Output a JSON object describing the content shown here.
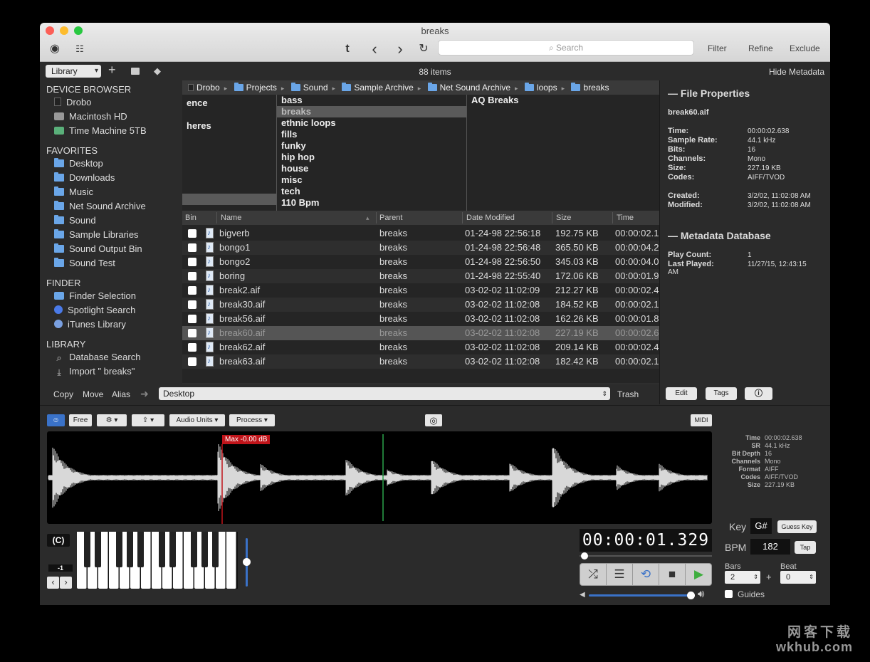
{
  "window": {
    "title": "breaks"
  },
  "toolbar": {
    "search_placeholder": "Search",
    "filter": "Filter",
    "refine": "Refine",
    "exclude": "Exclude",
    "back_icon": "‹",
    "forward_icon": "›"
  },
  "subbar": {
    "library_select": "Library",
    "item_count": "88 items",
    "hide_metadata": "Hide Metadata"
  },
  "sidebar": {
    "device_browser": {
      "header": "DEVICE BROWSER",
      "items": [
        "Drobo",
        "Macintosh HD",
        "Time Machine 5TB"
      ]
    },
    "favorites": {
      "header": "FAVORITES",
      "items": [
        "Desktop",
        "Downloads",
        "Music",
        "Net Sound Archive",
        "Sound",
        "Sample Libraries",
        "Sound Output Bin",
        "Sound Test"
      ]
    },
    "finder": {
      "header": "FINDER",
      "items": [
        "Finder Selection",
        "Spotlight Search",
        "iTunes Library"
      ]
    },
    "library": {
      "header": "LIBRARY",
      "items": [
        "Database Search",
        "Import \" breaks\""
      ]
    }
  },
  "path": [
    "Drobo",
    "Projects",
    "Sound",
    "Sample Archive",
    "Net Sound Archive",
    "loops",
    "breaks"
  ],
  "columns": {
    "col1": [
      "ence",
      "heres"
    ],
    "col2": [
      "bass",
      "breaks",
      "ethnic loops",
      "fills",
      "funky",
      "hip hop",
      "house",
      "misc",
      "tech",
      "110 Bpm"
    ],
    "col3": [
      "AQ Breaks"
    ]
  },
  "table": {
    "headers": {
      "bin": "Bin",
      "name": "Name",
      "parent": "Parent",
      "date": "Date Modified",
      "size": "Size",
      "time": "Time"
    },
    "rows": [
      {
        "name": "bigverb",
        "parent": "breaks",
        "date": "01-24-98 22:56:18",
        "size": "192.75 KB",
        "time": "00:00:02.1"
      },
      {
        "name": "bongo1",
        "parent": "breaks",
        "date": "01-24-98 22:56:48",
        "size": "365.50 KB",
        "time": "00:00:04.2"
      },
      {
        "name": "bongo2",
        "parent": "breaks",
        "date": "01-24-98 22:56:50",
        "size": "345.03 KB",
        "time": "00:00:04.0"
      },
      {
        "name": "boring",
        "parent": "breaks",
        "date": "01-24-98 22:55:40",
        "size": "172.06 KB",
        "time": "00:00:01.9"
      },
      {
        "name": "break2.aif",
        "parent": "breaks",
        "date": "03-02-02 11:02:09",
        "size": "212.27 KB",
        "time": "00:00:02.4"
      },
      {
        "name": "break30.aif",
        "parent": "breaks",
        "date": "03-02-02 11:02:08",
        "size": "184.52 KB",
        "time": "00:00:02.1"
      },
      {
        "name": "break56.aif",
        "parent": "breaks",
        "date": "03-02-02 11:02:08",
        "size": "162.26 KB",
        "time": "00:00:01.8"
      },
      {
        "name": "break60.aif",
        "parent": "breaks",
        "date": "03-02-02 11:02:08",
        "size": "227.19 KB",
        "time": "00:00:02.6"
      },
      {
        "name": "break62.aif",
        "parent": "breaks",
        "date": "03-02-02 11:02:08",
        "size": "209.14 KB",
        "time": "00:00:02.4"
      },
      {
        "name": "break63.aif",
        "parent": "breaks",
        "date": "03-02-02 11:02:08",
        "size": "182.42 KB",
        "time": "00:00:02.1"
      }
    ]
  },
  "bottom_bar": {
    "copy": "Copy",
    "move": "Move",
    "alias": "Alias",
    "destination": "Desktop",
    "trash": "Trash"
  },
  "metadata": {
    "file_props_header": "— File Properties",
    "filename": "break60.aif",
    "props": [
      {
        "k": "Time:",
        "v": "00:00:02.638"
      },
      {
        "k": "Sample Rate:",
        "v": "44.1 kHz"
      },
      {
        "k": "Bits:",
        "v": "16"
      },
      {
        "k": "Channels:",
        "v": "Mono"
      },
      {
        "k": "Size:",
        "v": "227.19 KB"
      },
      {
        "k": "Codes:",
        "v": "AIFF/TVOD"
      }
    ],
    "dates": [
      {
        "k": "Created:",
        "v": "3/2/02, 11:02:08 AM"
      },
      {
        "k": "Modified:",
        "v": "3/2/02, 11:02:08 AM"
      }
    ],
    "db_header": "— Metadata Database",
    "db": [
      {
        "k": "Play Count:",
        "v": "1"
      },
      {
        "k": "Last Played:",
        "v": "11/27/15, 12:43:15"
      }
    ],
    "db_cont": "AM",
    "edit": "Edit",
    "tags": "Tags"
  },
  "player": {
    "free": "Free",
    "audio_units": "Audio Units",
    "process": "Process",
    "midi": "MIDI",
    "max_label": "Max -0.00 dB",
    "info": [
      {
        "k": "Time",
        "v": "00:00:02.638"
      },
      {
        "k": "SR",
        "v": "44.1 kHz"
      },
      {
        "k": "Bit Depth",
        "v": "16"
      },
      {
        "k": "Channels",
        "v": "Mono"
      },
      {
        "k": "Format",
        "v": "AIFF"
      },
      {
        "k": "Codes",
        "v": "AIFF/TVOD"
      },
      {
        "k": "Size",
        "v": "227.19 KB"
      }
    ],
    "octave_key": "(C)",
    "octave_offset": "-1",
    "timer": "00:00:01.329",
    "key_label": "Key",
    "key_value": "G#",
    "guess_key": "Guess Key",
    "bpm_label": "BPM",
    "bpm_value": "182",
    "tap": "Tap",
    "bars_label": "Bars",
    "bars_value": "2",
    "beat_label": "Beat",
    "beat_value": "0",
    "plus": "+",
    "guides": "Guides"
  },
  "watermark": {
    "cn": "网客下载",
    "en": "wkhub.com"
  }
}
